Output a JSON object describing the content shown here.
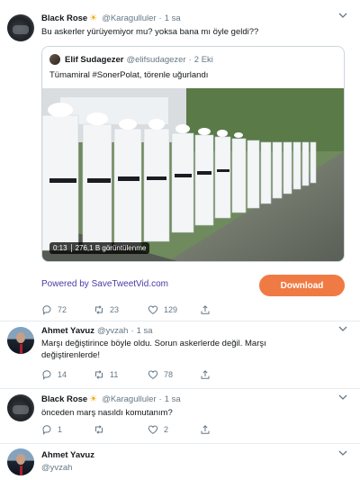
{
  "tweet1": {
    "name": "Black Rose",
    "emoji": "☀",
    "handle": "@Karagulluler",
    "dot": "·",
    "time": "1 sa",
    "text": "Bu askerler yürüyemiyor mu? yoksa bana mı öyle geldi??",
    "quote": {
      "name": "Elif Sudagezer",
      "handle": "@elifsudagezer",
      "dot": "·",
      "time": "2 Eki",
      "text": "Tümamiral #SonerPolat, törenle uğurlandı",
      "video_duration": "0:13",
      "video_views": "276,1 B görüntülenme"
    },
    "powered_by": "Powered by SaveTweetVid.com",
    "download_label": "Download",
    "replies": "72",
    "retweets": "23",
    "likes": "129"
  },
  "tweet2": {
    "name": "Ahmet Yavuz",
    "handle": "@yvzah",
    "dot": "·",
    "time": "1 sa",
    "text": "Marşı değiştirince böyle oldu. Sorun askerlerde değil. Marşı değiştirenlerde!",
    "replies": "14",
    "retweets": "11",
    "likes": "78"
  },
  "tweet3": {
    "name": "Black Rose",
    "emoji": "☀",
    "handle": "@Karagulluler",
    "dot": "·",
    "time": "1 sa",
    "text": "önceden marş nasıldı komutanım?",
    "replies": "1",
    "retweets": "",
    "likes": "2"
  },
  "tweet4": {
    "name": "Ahmet Yavuz",
    "handle": "@yvzah"
  },
  "colors": {
    "accent": "#f07a43",
    "link": "#4b3aa3",
    "muted": "#657786",
    "border": "#ccd6dd"
  },
  "icons": [
    "chevron-down-icon",
    "reply-icon",
    "retweet-icon",
    "like-icon",
    "share-icon",
    "sun-emoji-icon"
  ]
}
